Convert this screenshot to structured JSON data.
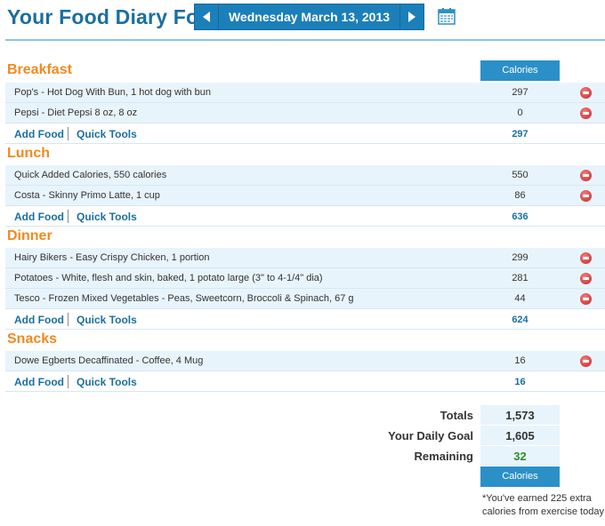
{
  "header": {
    "title": "Your Food Diary For:",
    "date": "Wednesday March 13, 2013",
    "prev_icon": "chevron-left-icon",
    "next_icon": "chevron-right-icon",
    "calendar_icon": "calendar-icon"
  },
  "columns": {
    "calories": "Calories"
  },
  "links": {
    "add_food": "Add Food",
    "quick_tools": "Quick Tools"
  },
  "meals": [
    {
      "name": "Breakfast",
      "items": [
        {
          "food": "Pop's - Hot Dog With Bun, 1 hot dog with bun",
          "calories": "297"
        },
        {
          "food": "Pepsi - Diet Pepsi 8 oz, 8 oz",
          "calories": "0"
        }
      ],
      "total": "297"
    },
    {
      "name": "Lunch",
      "items": [
        {
          "food": "Quick Added Calories, 550 calories",
          "calories": "550"
        },
        {
          "food": "Costa - Skinny Primo Latte, 1 cup",
          "calories": "86"
        }
      ],
      "total": "636"
    },
    {
      "name": "Dinner",
      "items": [
        {
          "food": "Hairy Bikers - Easy Crispy Chicken, 1 portion",
          "calories": "299"
        },
        {
          "food": "Potatoes - White, flesh and skin, baked, 1 potato large (3\" to 4-1/4\" dia)",
          "calories": "281"
        },
        {
          "food": "Tesco - Frozen Mixed Vegetables - Peas, Sweetcorn, Broccoli & Spinach, 67 g",
          "calories": "44"
        }
      ],
      "total": "624"
    },
    {
      "name": "Snacks",
      "items": [
        {
          "food": "Dowe Egberts Decaffinated - Coffee, 4 Mug",
          "calories": "16"
        }
      ],
      "total": "16"
    }
  ],
  "summary": {
    "totals_label": "Totals",
    "totals_value": "1,573",
    "goal_label": "Your Daily Goal",
    "goal_value": "1,605",
    "remaining_label": "Remaining",
    "remaining_value": "32",
    "footer_col": "Calories",
    "note": "*You've earned 225 extra calories from exercise today"
  },
  "colors": {
    "accent": "#1b7fba",
    "meal_title": "#f08a20",
    "row_bg": "#e8f4fb",
    "remaining": "#2e8b2e"
  }
}
